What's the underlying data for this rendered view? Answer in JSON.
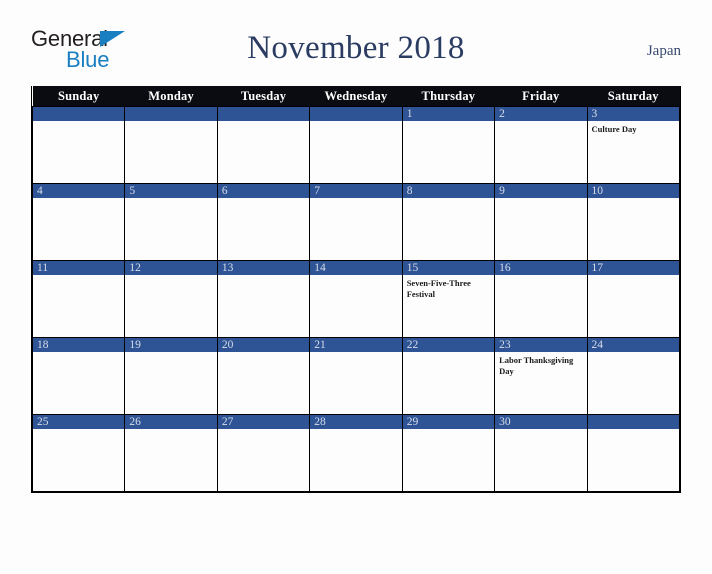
{
  "logo": {
    "word_top": "General",
    "word_bottom": "Blue",
    "triangle_icon": "triangle-icon",
    "accent_color": "#1a7fc1",
    "text_color": "#231f20"
  },
  "header": {
    "title": "November 2018",
    "country": "Japan",
    "title_color": "#2b3c62"
  },
  "calendar": {
    "month": "November",
    "year": "2018",
    "header_bg": "#0b0c12",
    "daynum_bg": "#2e5496",
    "weekdays": [
      "Sunday",
      "Monday",
      "Tuesday",
      "Wednesday",
      "Thursday",
      "Friday",
      "Saturday"
    ],
    "weeks": [
      [
        {
          "day": "",
          "event": ""
        },
        {
          "day": "",
          "event": ""
        },
        {
          "day": "",
          "event": ""
        },
        {
          "day": "",
          "event": ""
        },
        {
          "day": "1",
          "event": ""
        },
        {
          "day": "2",
          "event": ""
        },
        {
          "day": "3",
          "event": "Culture Day"
        }
      ],
      [
        {
          "day": "4",
          "event": ""
        },
        {
          "day": "5",
          "event": ""
        },
        {
          "day": "6",
          "event": ""
        },
        {
          "day": "7",
          "event": ""
        },
        {
          "day": "8",
          "event": ""
        },
        {
          "day": "9",
          "event": ""
        },
        {
          "day": "10",
          "event": ""
        }
      ],
      [
        {
          "day": "11",
          "event": ""
        },
        {
          "day": "12",
          "event": ""
        },
        {
          "day": "13",
          "event": ""
        },
        {
          "day": "14",
          "event": ""
        },
        {
          "day": "15",
          "event": "Seven-Five-Three Festival"
        },
        {
          "day": "16",
          "event": ""
        },
        {
          "day": "17",
          "event": ""
        }
      ],
      [
        {
          "day": "18",
          "event": ""
        },
        {
          "day": "19",
          "event": ""
        },
        {
          "day": "20",
          "event": ""
        },
        {
          "day": "21",
          "event": ""
        },
        {
          "day": "22",
          "event": ""
        },
        {
          "day": "23",
          "event": "Labor Thanksgiving Day"
        },
        {
          "day": "24",
          "event": ""
        }
      ],
      [
        {
          "day": "25",
          "event": ""
        },
        {
          "day": "26",
          "event": ""
        },
        {
          "day": "27",
          "event": ""
        },
        {
          "day": "28",
          "event": ""
        },
        {
          "day": "29",
          "event": ""
        },
        {
          "day": "30",
          "event": ""
        },
        {
          "day": "",
          "event": ""
        }
      ]
    ]
  }
}
